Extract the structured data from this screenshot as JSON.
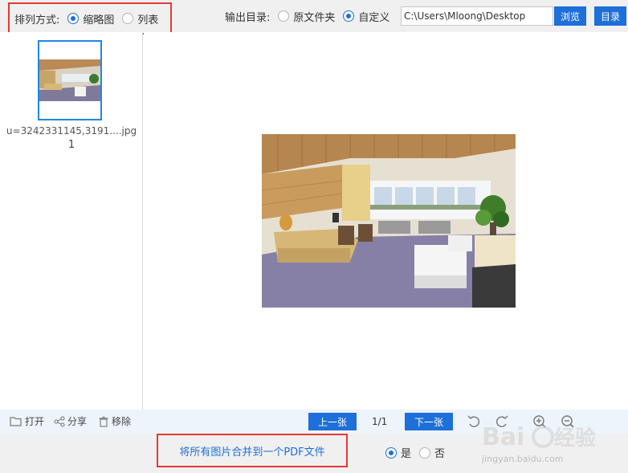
{
  "sort": {
    "label": "排列方式:",
    "options": [
      {
        "label": "缩略图",
        "checked": true
      },
      {
        "label": "列表",
        "checked": false
      }
    ]
  },
  "output": {
    "label": "输出目录:",
    "options": [
      {
        "label": "原文件夹",
        "checked": false
      },
      {
        "label": "自定义",
        "checked": true
      }
    ],
    "path_value": "C:\\Users\\Mloong\\Desktop",
    "browse_label": "浏览",
    "dir_label": "目录"
  },
  "file_list": {
    "items": [
      {
        "name": "u=3242331145,3191....jpg",
        "index": "1"
      }
    ]
  },
  "tools": {
    "open_label": "打开",
    "share_label": "分享",
    "remove_label": "移除"
  },
  "pager": {
    "prev_label": "上一张",
    "page": "1/1",
    "next_label": "下一张"
  },
  "merge": {
    "label": "将所有图片合并到一个PDF文件",
    "options": [
      {
        "label": "是",
        "checked": true
      },
      {
        "label": "否",
        "checked": false
      }
    ]
  },
  "colors": {
    "accent": "#1e6fd9",
    "highlight": "#e53935"
  },
  "watermark": {
    "url": "jingyan.baidu.com"
  }
}
